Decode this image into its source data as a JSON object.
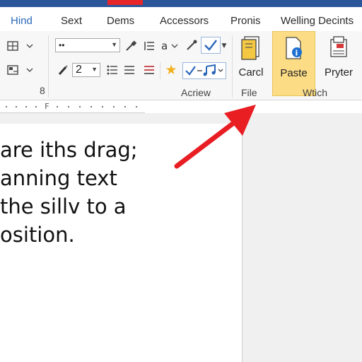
{
  "tabs": [
    "Hind",
    "Sext",
    "Dems",
    "Accessors",
    "Pronis",
    "Welling Decints"
  ],
  "ribbon": {
    "font_combo_value": "••",
    "size_value": "2",
    "group_number": "8",
    "group_labels": {
      "left": "Acriew",
      "file": "File",
      "right": "Wtich"
    },
    "buttons": {
      "card": "Carcl",
      "paste": "Paste",
      "printer": "Pryter"
    }
  },
  "ruler": {
    "marker": "F"
  },
  "document": {
    "lines": [
      "are iths drag;",
      "anning text",
      "the sillv to a",
      "osition."
    ]
  },
  "colors": {
    "titlebar": "#2b579a",
    "accent_red": "#e8262a",
    "active_tab": "#2b67b8",
    "paste_highlight": "#fcdd86",
    "arrow": "#e81e23"
  },
  "annotation": {
    "type": "red-arrow",
    "points_to": "file-group"
  }
}
